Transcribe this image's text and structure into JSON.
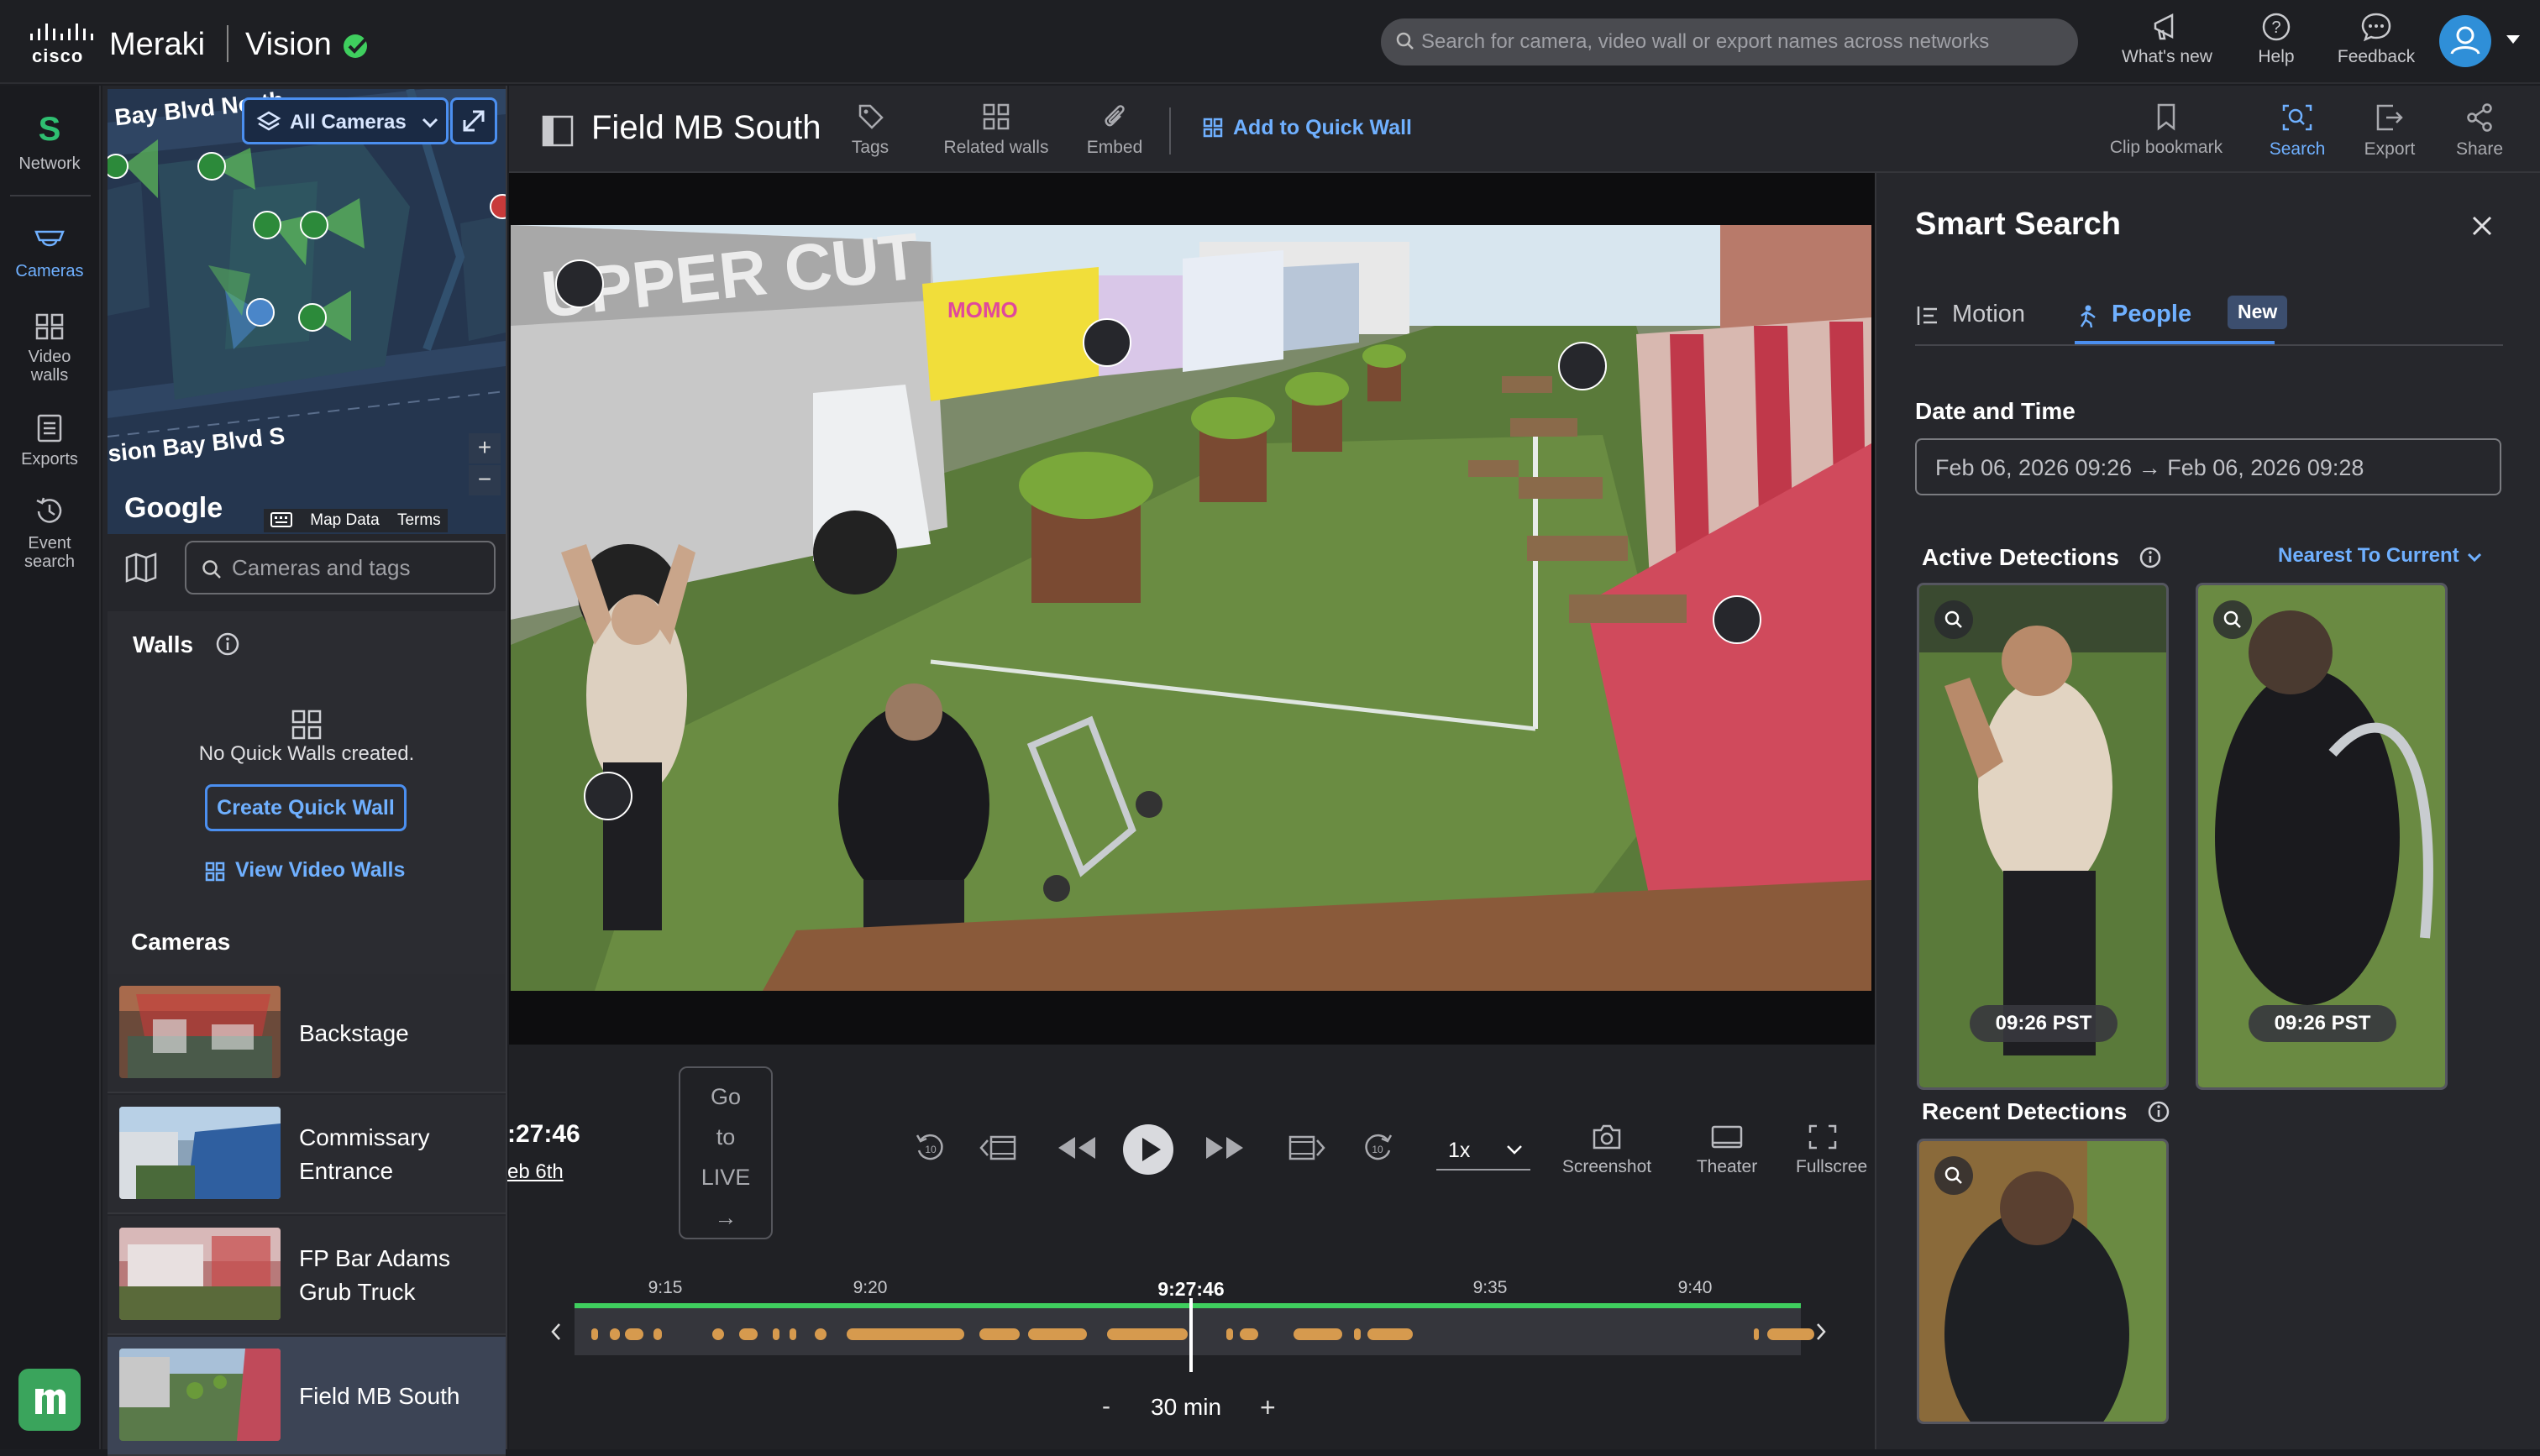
{
  "topbar": {
    "brand_company": "cisco",
    "brand_meraki": "Meraki",
    "brand_product": "Vision",
    "search_placeholder": "Search for camera, video wall or export names across networks",
    "actions": [
      {
        "label": "What's new",
        "icon": "megaphone-icon"
      },
      {
        "label": "Help",
        "icon": "help-icon"
      },
      {
        "label": "Feedback",
        "icon": "feedback-icon"
      }
    ]
  },
  "leftnav": {
    "network_letter": "S",
    "items": [
      {
        "label": "Network",
        "icon": "network-icon"
      },
      {
        "label": "Cameras",
        "icon": "camera-icon",
        "active": true
      },
      {
        "label": "Video walls",
        "icon": "video-walls-icon"
      },
      {
        "label": "Exports",
        "icon": "exports-icon"
      },
      {
        "label": "Event search",
        "icon": "event-search-icon"
      }
    ]
  },
  "map": {
    "filter_label": "All Cameras",
    "road_top": "Bay Blvd North",
    "road_bottom": "sion Bay Blvd S",
    "google_label": "Google",
    "map_data_label": "Map Data",
    "terms_label": "Terms",
    "zoom_in": "+",
    "zoom_out": "−"
  },
  "camera_search": {
    "placeholder": "Cameras and tags"
  },
  "walls": {
    "title": "Walls",
    "empty_text": "No Quick Walls created.",
    "create_button": "Create Quick Wall",
    "view_link": "View Video Walls"
  },
  "cameras": {
    "title": "Cameras",
    "items": [
      {
        "name": "Backstage"
      },
      {
        "name": "Commissary Entrance"
      },
      {
        "name": "FP Bar Adams Grub Truck"
      },
      {
        "name": "Field MB South",
        "selected": true
      }
    ]
  },
  "header": {
    "camera_title": "Field MB South",
    "actions_left": [
      {
        "label": "Tags",
        "icon": "tag-icon"
      },
      {
        "label": "Related walls",
        "icon": "related-walls-icon"
      },
      {
        "label": "Embed",
        "icon": "paperclip-icon"
      }
    ],
    "add_quick_wall": "Add to Quick Wall",
    "actions_right": [
      {
        "label": "Clip bookmark",
        "icon": "bookmark-icon"
      },
      {
        "label": "Search",
        "icon": "search-icon",
        "active": true
      },
      {
        "label": "Export",
        "icon": "export-icon"
      },
      {
        "label": "Share",
        "icon": "share-icon"
      }
    ]
  },
  "video": {
    "sign_text": "UPPER CUT",
    "truck_text": "MOMO"
  },
  "player": {
    "current_time": ":27:46",
    "current_date": "eb 6th",
    "go_live_lines": [
      "Go",
      "to",
      "LIVE",
      "→"
    ],
    "speed": "1x",
    "actions": [
      {
        "label": "Screenshot",
        "icon": "screenshot-icon"
      },
      {
        "label": "Theater",
        "icon": "theater-icon"
      },
      {
        "label": "Fullscree",
        "icon": "fullscreen-icon"
      }
    ]
  },
  "timeline": {
    "ticks": [
      "9:15",
      "9:20",
      "9:27:46",
      "9:35",
      "9:40"
    ],
    "current_tick": "9:27:46",
    "zoom_minus": "-",
    "zoom_value": "30 min",
    "zoom_plus": "+"
  },
  "smart_search": {
    "title": "Smart Search",
    "tabs": [
      {
        "label": "Motion",
        "icon": "motion-icon"
      },
      {
        "label": "People",
        "icon": "person-icon",
        "active": true,
        "badge": "New"
      }
    ],
    "date_label": "Date and Time",
    "date_range": "Feb 06, 2026 09:26 → Feb 06, 2026 09:28",
    "active_label": "Active Detections",
    "sort_label": "Nearest To Current",
    "active_detections": [
      {
        "time": "09:26 PST"
      },
      {
        "time": "09:26 PST"
      }
    ],
    "recent_label": "Recent Detections"
  },
  "colors": {
    "accent": "#4b8ff0",
    "accent_text": "#6fb0ff",
    "timeline_green": "#3fce5e",
    "motion_segment": "#d69a4e",
    "brand_green": "#3aa45c"
  }
}
